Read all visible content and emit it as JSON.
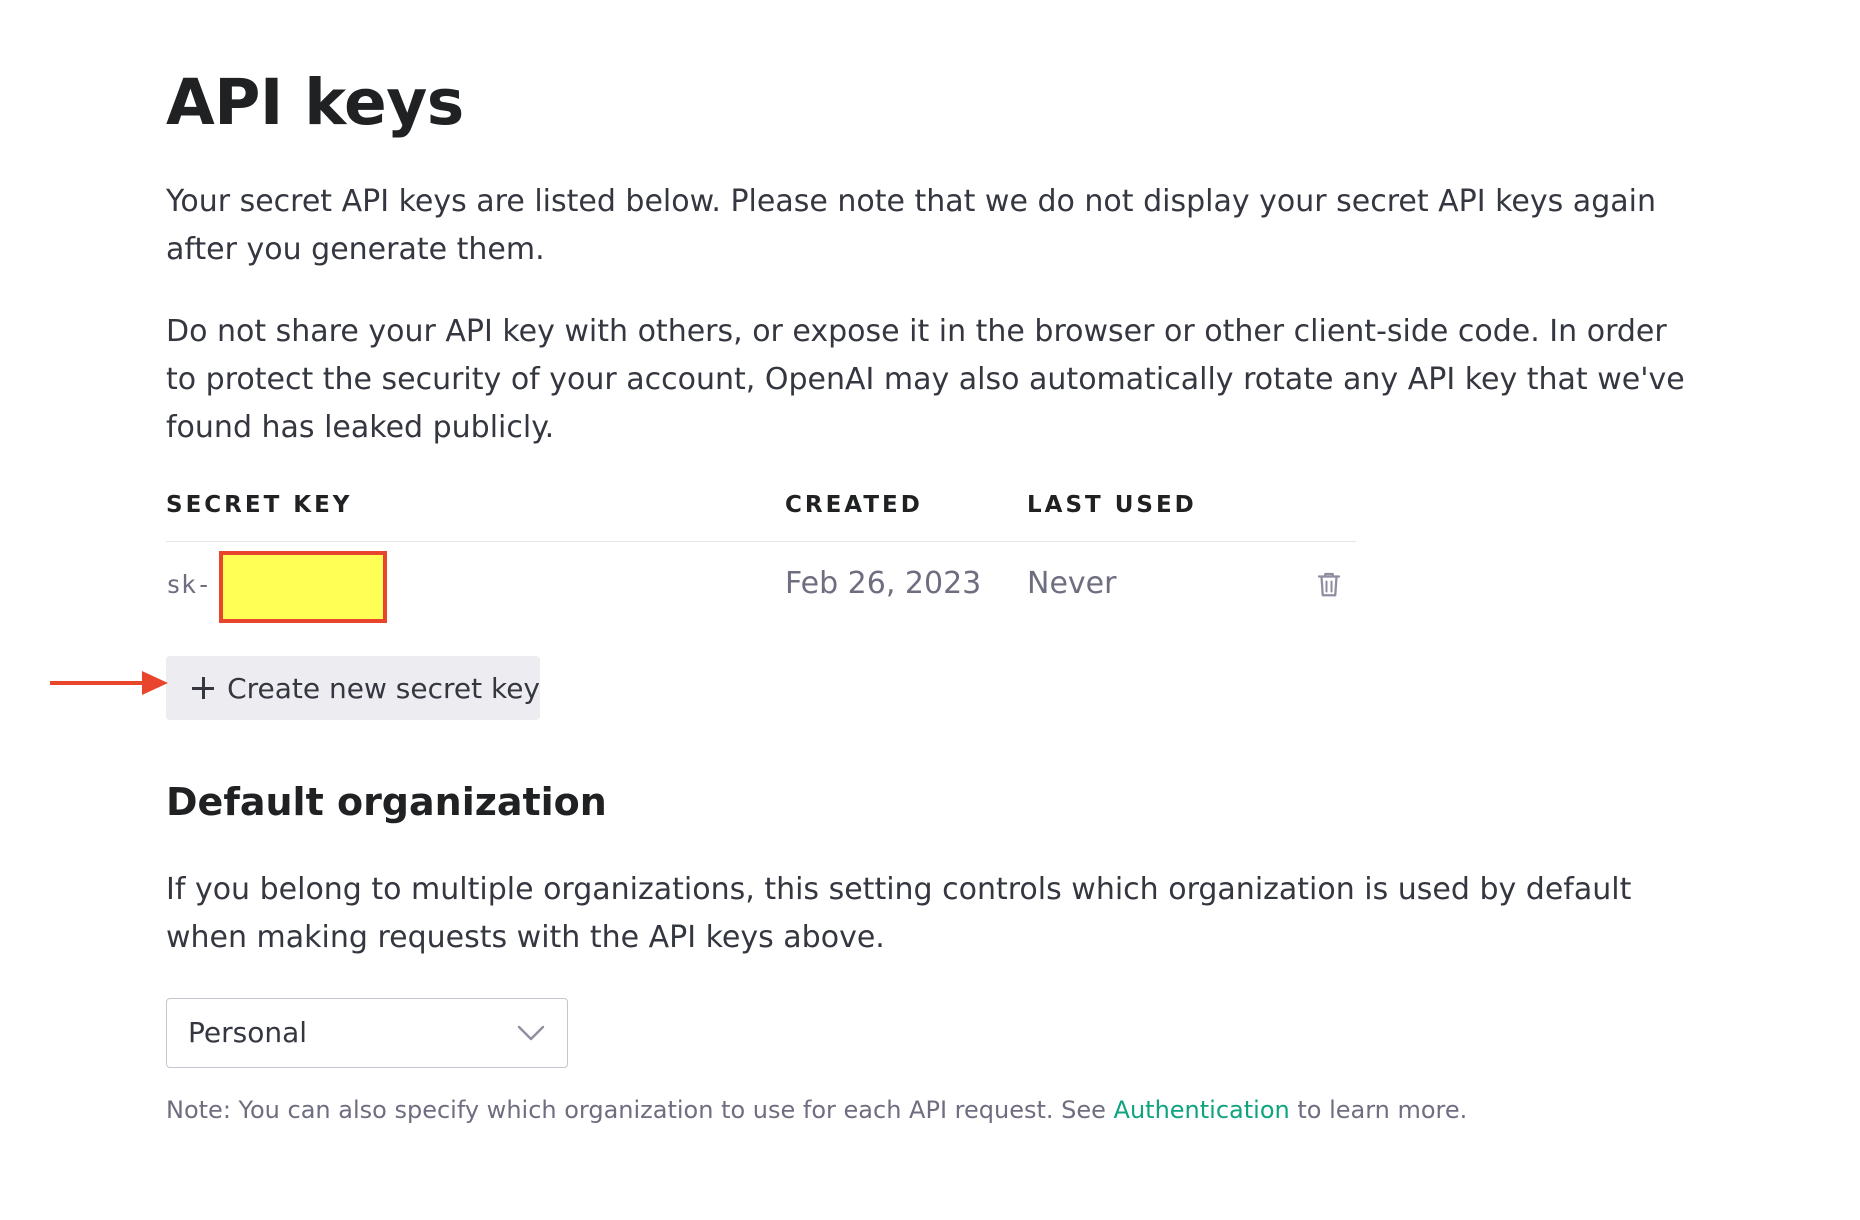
{
  "page": {
    "title": "API keys",
    "intro_1": "Your secret API keys are listed below. Please note that we do not display your secret API keys again after you generate them.",
    "intro_2": "Do not share your API key with others, or expose it in the browser or other client-side code. In order to protect the security of your account, OpenAI may also automatically rotate any API key that we've found has leaked publicly."
  },
  "keys_table": {
    "columns": [
      "SECRET KEY",
      "CREATED",
      "LAST USED"
    ],
    "rows": [
      {
        "key_prefix": "sk-",
        "created": "Feb 26, 2023",
        "last_used": "Never",
        "delete_icon": "trash-icon"
      }
    ]
  },
  "create_button": {
    "icon": "plus-icon",
    "label": "Create new secret key"
  },
  "annotation": {
    "redaction_color": "#ffff55",
    "highlight_color": "#e8452c",
    "arrow_icon": "arrow-right-icon"
  },
  "default_org": {
    "heading": "Default organization",
    "description": "If you belong to multiple organizations, this setting controls which organization is used by default when making requests with the API keys above.",
    "select_value": "Personal",
    "select_icon": "chevron-down-icon",
    "note_prefix": "Note: You can also specify which organization to use for each API request. See ",
    "note_link": "Authentication",
    "note_suffix": " to learn more.",
    "link_color": "#10a37f"
  }
}
